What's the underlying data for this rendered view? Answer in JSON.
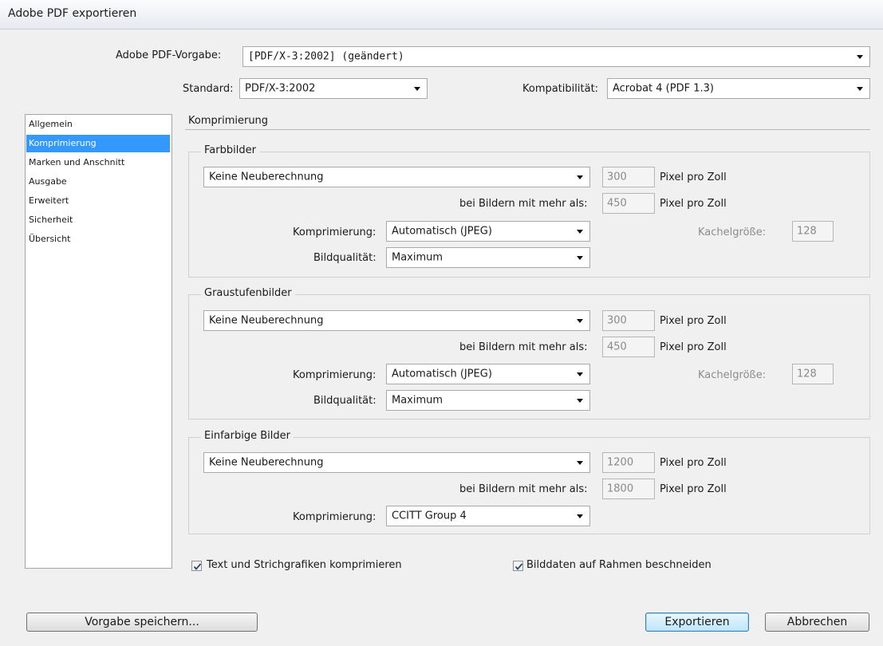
{
  "window": {
    "title": "Adobe PDF exportieren"
  },
  "header": {
    "preset_label": "Adobe PDF-Vorgabe:",
    "preset_value": "[PDF/X-3:2002] (geändert)",
    "standard_label": "Standard:",
    "standard_value": "PDF/X-3:2002",
    "compat_label": "Kompatibilität:",
    "compat_value": "Acrobat 4 (PDF 1.3)"
  },
  "sidebar": {
    "items": [
      {
        "label": "Allgemein"
      },
      {
        "label": "Komprimierung"
      },
      {
        "label": "Marken und Anschnitt"
      },
      {
        "label": "Ausgabe"
      },
      {
        "label": "Erweitert"
      },
      {
        "label": "Sicherheit"
      },
      {
        "label": "Übersicht"
      }
    ]
  },
  "main": {
    "section_title": "Komprimierung",
    "color": {
      "title": "Farbbilder",
      "resample": "Keine Neuberechnung",
      "ppi": "300",
      "ppi_unit": "Pixel pro Zoll",
      "above_label": "bei Bildern mit mehr als:",
      "above_value": "450",
      "above_unit": "Pixel pro Zoll",
      "compression_label": "Komprimierung:",
      "compression": "Automatisch (JPEG)",
      "tile_label": "Kachelgröße:",
      "tile_value": "128",
      "quality_label": "Bildqualität:",
      "quality": "Maximum"
    },
    "gray": {
      "title": "Graustufenbilder",
      "resample": "Keine Neuberechnung",
      "ppi": "300",
      "ppi_unit": "Pixel pro Zoll",
      "above_label": "bei Bildern mit mehr als:",
      "above_value": "450",
      "above_unit": "Pixel pro Zoll",
      "compression_label": "Komprimierung:",
      "compression": "Automatisch (JPEG)",
      "tile_label": "Kachelgröße:",
      "tile_value": "128",
      "quality_label": "Bildqualität:",
      "quality": "Maximum"
    },
    "mono": {
      "title": "Einfarbige Bilder",
      "resample": "Keine Neuberechnung",
      "ppi": "1200",
      "ppi_unit": "Pixel pro Zoll",
      "above_label": "bei Bildern mit mehr als:",
      "above_value": "1800",
      "above_unit": "Pixel pro Zoll",
      "compression_label": "Komprimierung:",
      "compression": "CCITT Group 4"
    },
    "check_text": "Text und Strichgrafiken komprimieren",
    "check_crop": "Bilddaten auf Rahmen beschneiden"
  },
  "footer": {
    "save_preset": "Vorgabe speichern...",
    "export": "Exportieren",
    "cancel": "Abbrechen"
  }
}
